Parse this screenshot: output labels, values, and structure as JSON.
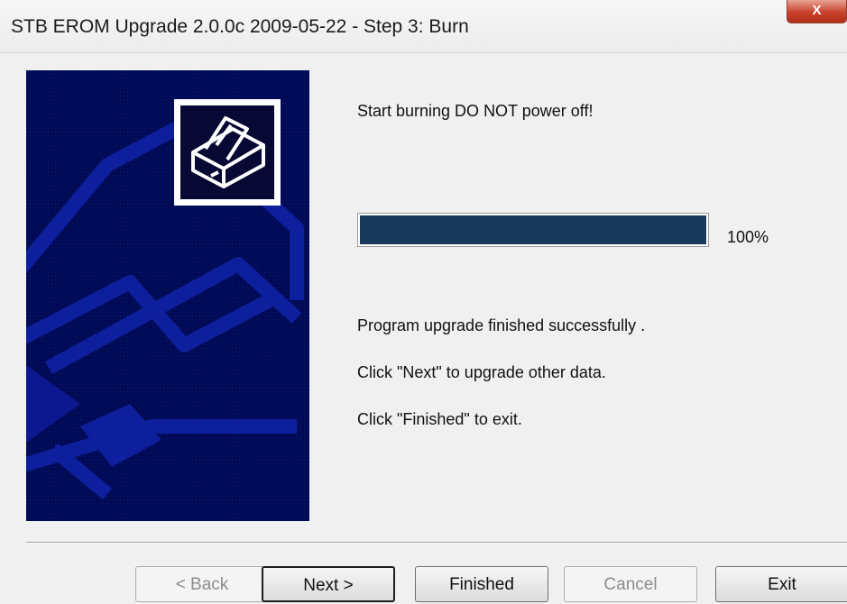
{
  "window": {
    "title": "STB EROM Upgrade 2.0.0c 2009-05-22 - Step 3: Burn",
    "close_glyph": "X"
  },
  "side_panel": {
    "icon": "printer-icon",
    "background_color": "#000a55"
  },
  "content": {
    "status_message": "Start burning  DO NOT power off!",
    "progress": {
      "value": 1.0,
      "percent_label": "100%"
    },
    "success_message": "Program upgrade finished successfully .",
    "next_hint": "Click \"Next\" to upgrade other data.",
    "finish_hint": "Click \"Finished\" to exit."
  },
  "buttons": {
    "back": "< Back",
    "next": "Next >",
    "finished": "Finished",
    "cancel": "Cancel",
    "exit": "Exit"
  },
  "colors": {
    "progress_fill": "#1a3a5c",
    "panel_background": "#f0f0f0"
  }
}
